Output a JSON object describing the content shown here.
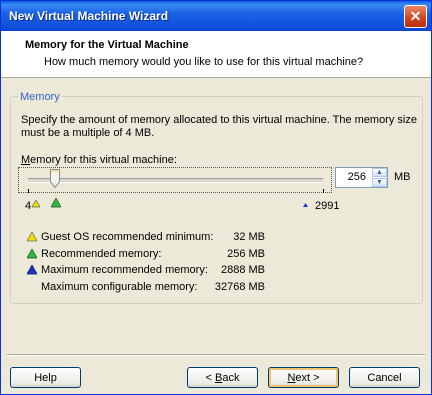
{
  "window": {
    "title": "New Virtual Machine Wizard",
    "close_icon": "close-icon"
  },
  "header": {
    "title": "Memory for the Virtual Machine",
    "subtitle": "How much memory would you like to use for this virtual machine?"
  },
  "group": {
    "label": "Memory",
    "description": "Specify the amount of memory allocated to this virtual machine. The memory size must be a multiple of 4 MB.",
    "slider_label": "Memory for this virtual machine:",
    "value": "256",
    "unit": "MB",
    "marks": {
      "min": "4",
      "max": "2991"
    }
  },
  "legend": [
    {
      "icon": "yellow-triangle-icon",
      "color": "#f0e000",
      "label": "Guest OS recommended minimum:",
      "value": "32 MB"
    },
    {
      "icon": "green-triangle-icon",
      "color": "#2fb83f",
      "label": "Recommended memory:",
      "value": "256 MB"
    },
    {
      "icon": "blue-triangle-icon",
      "color": "#1c33c2",
      "label": "Maximum recommended memory:",
      "value": "2888 MB"
    },
    {
      "icon": "",
      "color": "",
      "label": "Maximum configurable memory:",
      "value": "32768 MB"
    }
  ],
  "buttons": {
    "help": "Help",
    "back": "< Back",
    "next": "Next >",
    "cancel": "Cancel"
  }
}
